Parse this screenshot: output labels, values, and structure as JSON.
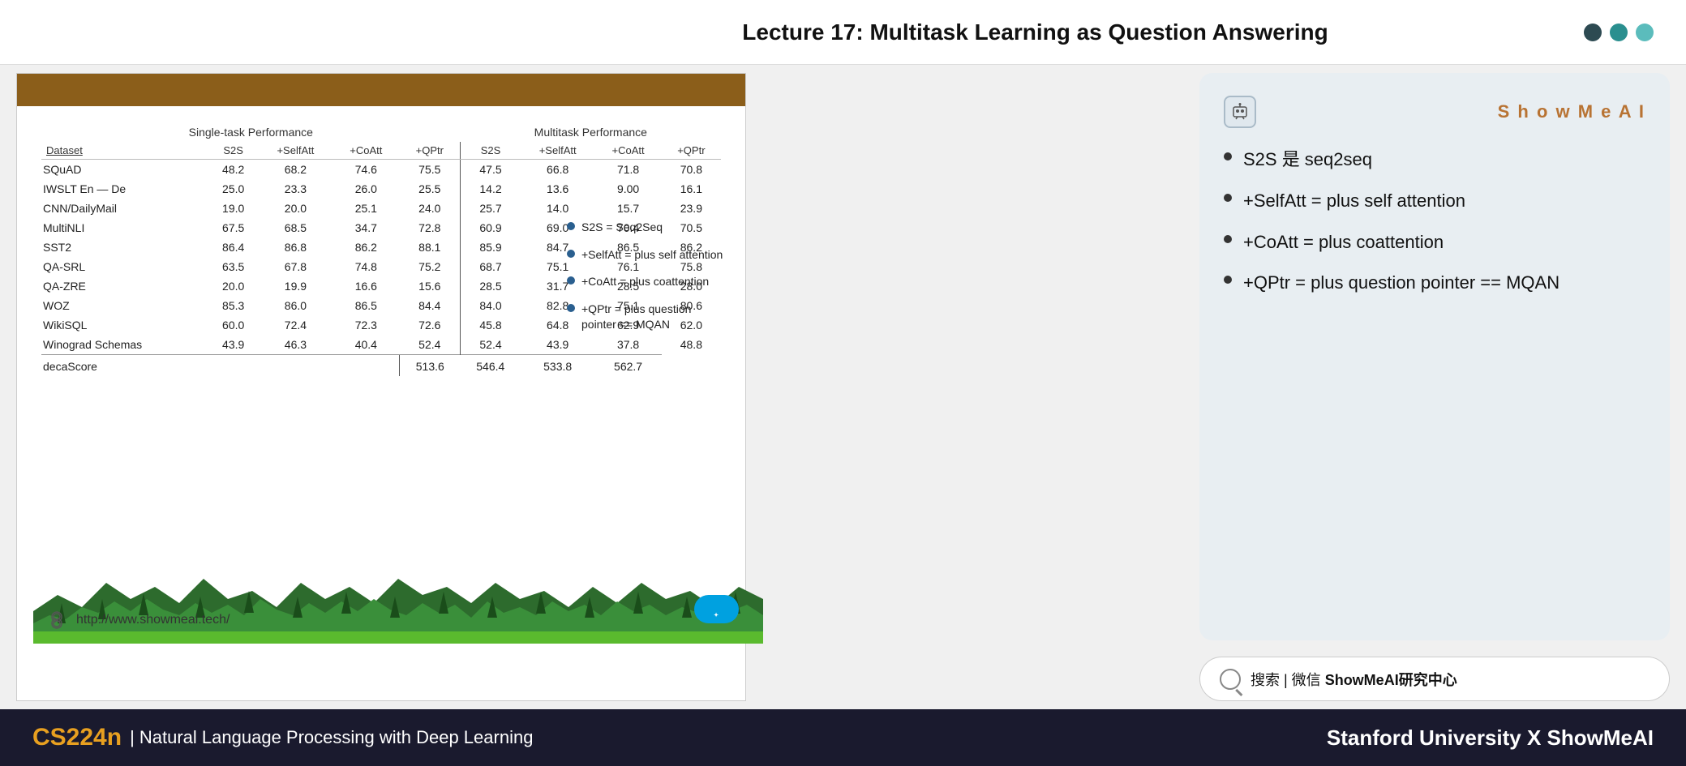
{
  "header": {
    "title": "Lecture 17: Multitask Learning as Question Answering"
  },
  "nav_dots": [
    {
      "color": "dark"
    },
    {
      "color": "teal"
    },
    {
      "color": "light-teal"
    }
  ],
  "slide": {
    "table": {
      "group_headers": [
        "Single-task Performance",
        "Multitask Performance"
      ],
      "columns": [
        "Dataset",
        "S2S",
        "+SelfAtt",
        "+CoAtt",
        "+QPtr",
        "S2S",
        "+SelfAtt",
        "+CoAtt",
        "+QPtr"
      ],
      "rows": [
        [
          "SQuAD",
          "48.2",
          "68.2",
          "74.6",
          "75.5",
          "47.5",
          "66.8",
          "71.8",
          "70.8"
        ],
        [
          "IWSLT En — De",
          "25.0",
          "23.3",
          "26.0",
          "25.5",
          "14.2",
          "13.6",
          "9.00",
          "16.1"
        ],
        [
          "CNN/DailyMail",
          "19.0",
          "20.0",
          "25.1",
          "24.0",
          "25.7",
          "14.0",
          "15.7",
          "23.9"
        ],
        [
          "MultiNLI",
          "67.5",
          "68.5",
          "34.7",
          "72.8",
          "60.9",
          "69.0",
          "70.4",
          "70.5"
        ],
        [
          "SST2",
          "86.4",
          "86.8",
          "86.2",
          "88.1",
          "85.9",
          "84.7",
          "86.5",
          "86.2"
        ],
        [
          "QA-SRL",
          "63.5",
          "67.8",
          "74.8",
          "75.2",
          "68.7",
          "75.1",
          "76.1",
          "75.8"
        ],
        [
          "QA-ZRE",
          "20.0",
          "19.9",
          "16.6",
          "15.6",
          "28.5",
          "31.7",
          "28.5",
          "28.0"
        ],
        [
          "WOZ",
          "85.3",
          "86.0",
          "86.5",
          "84.4",
          "84.0",
          "82.8",
          "75.1",
          "80.6"
        ],
        [
          "WikiSQL",
          "60.0",
          "72.4",
          "72.3",
          "72.6",
          "45.8",
          "64.8",
          "62.9",
          "62.0"
        ],
        [
          "Winograd Schemas",
          "43.9",
          "46.3",
          "40.4",
          "52.4",
          "52.4",
          "43.9",
          "37.8",
          "48.8"
        ]
      ],
      "deca_row": [
        "decaScore",
        "",
        "",
        "",
        "513.6",
        "546.4",
        "533.8",
        "562.7"
      ]
    },
    "legend": [
      {
        "text": "S2S = Seq2Seq"
      },
      {
        "text": "+SelfAtt = plus self attention"
      },
      {
        "text": "+CoAtt = plus coattention"
      },
      {
        "text": "+QPtr = plus question pointer == MQAN"
      }
    ],
    "url": "http://www.showmeai.tech/"
  },
  "right_panel": {
    "brand": "ShowMeAI",
    "bullets": [
      {
        "text": "S2S 是 seq2seq"
      },
      {
        "text": "+SelfAtt = plus self attention"
      },
      {
        "text": "+CoAtt = plus coattention"
      },
      {
        "text": "+QPtr = plus question pointer == MQAN"
      }
    ],
    "search_label": "搜索 | 微信 ShowMeAI研究中心"
  },
  "footer": {
    "cs_label": "CS224n",
    "course_label": "| Natural Language Processing with Deep Learning",
    "university": "Stanford University",
    "x_label": "X ShowMeAI"
  }
}
